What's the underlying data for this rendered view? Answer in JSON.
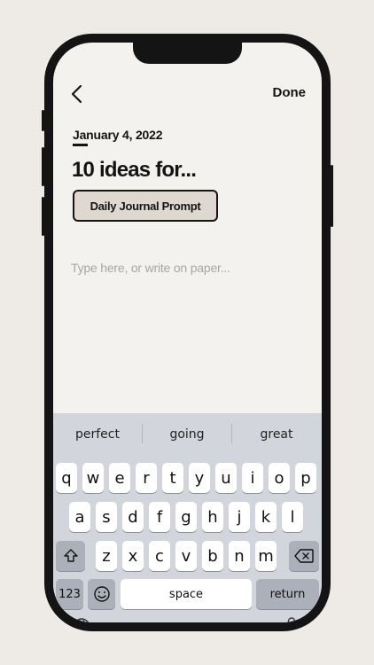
{
  "header": {
    "back_icon": "chevron-left-icon",
    "done_label": "Done"
  },
  "entry": {
    "date": "January 4, 2022",
    "title": "10 ideas for...",
    "prompt_tag": "Daily Journal Prompt",
    "placeholder": "Type here, or write on paper..."
  },
  "keyboard": {
    "suggestions": [
      "perfect",
      "going",
      "great"
    ],
    "rows": [
      [
        "q",
        "w",
        "e",
        "r",
        "t",
        "y",
        "u",
        "i",
        "o",
        "p"
      ],
      [
        "a",
        "s",
        "d",
        "f",
        "g",
        "h",
        "j",
        "k",
        "l"
      ],
      [
        "z",
        "x",
        "c",
        "v",
        "b",
        "n",
        "m"
      ]
    ],
    "numbers_label": "123",
    "space_label": "space",
    "return_label": "return",
    "icons": [
      "shift-icon",
      "backspace-icon",
      "emoji-icon",
      "globe-icon",
      "microphone-icon"
    ]
  },
  "colors": {
    "background": "#eeebe6",
    "screen": "#f4f2ef",
    "tag_fill": "#dfd8d0",
    "keyboard": "#d2d5dc"
  }
}
